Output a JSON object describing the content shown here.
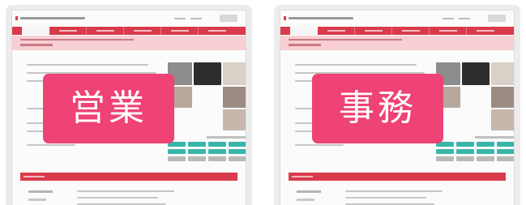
{
  "panels": [
    {
      "label": "営業",
      "accent": "#ee4374"
    },
    {
      "label": "事務",
      "accent": "#ee4374"
    }
  ],
  "colors": {
    "nav_red": "#d93b4a",
    "notice_pink": "#f7cfd4",
    "teal": "#39b6a9",
    "panel_bg": "#ececec"
  }
}
